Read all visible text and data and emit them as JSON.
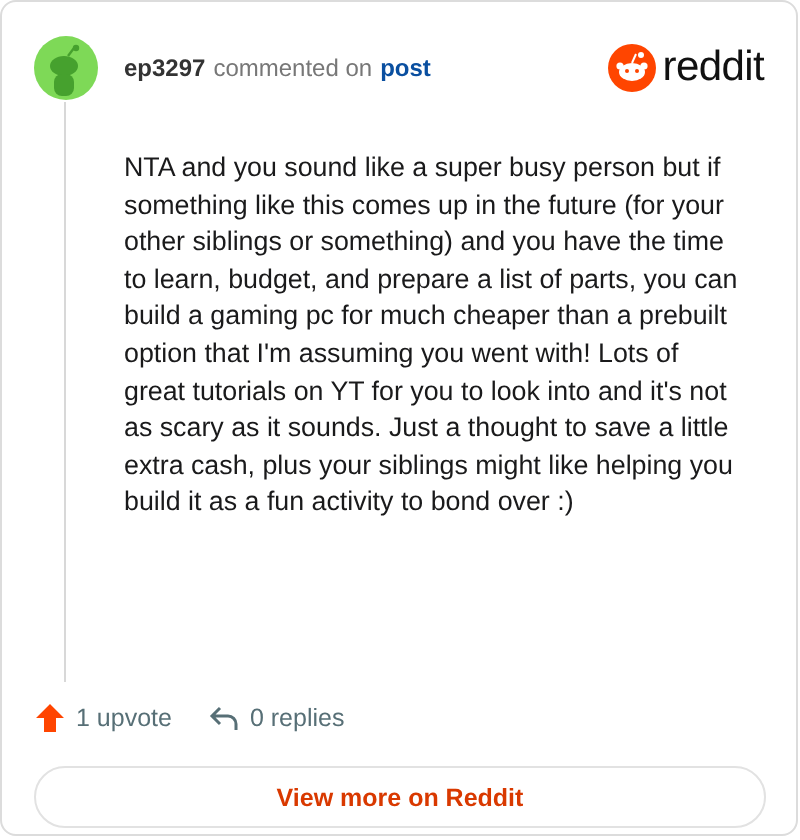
{
  "comment": {
    "author": "ep3297",
    "action": "commented on",
    "link": "post",
    "body": "NTA and you sound like a super busy person but if something like this comes up in the future (for your other siblings or something) and you have the time to learn, budget, and prepare a list of parts, you can build a gaming pc for much cheaper than a prebuilt option that I'm assuming you went with! Lots of great tutorials on YT for you to look into and it's not as scary as it sounds. Just a thought to save a little extra cash, plus your siblings might like helping you build it as a fun activity to bond over :)"
  },
  "logo": {
    "text": "reddit"
  },
  "footer": {
    "upvotes": "1 upvote",
    "replies": "0 replies"
  },
  "button": {
    "label": "View more on Reddit"
  }
}
